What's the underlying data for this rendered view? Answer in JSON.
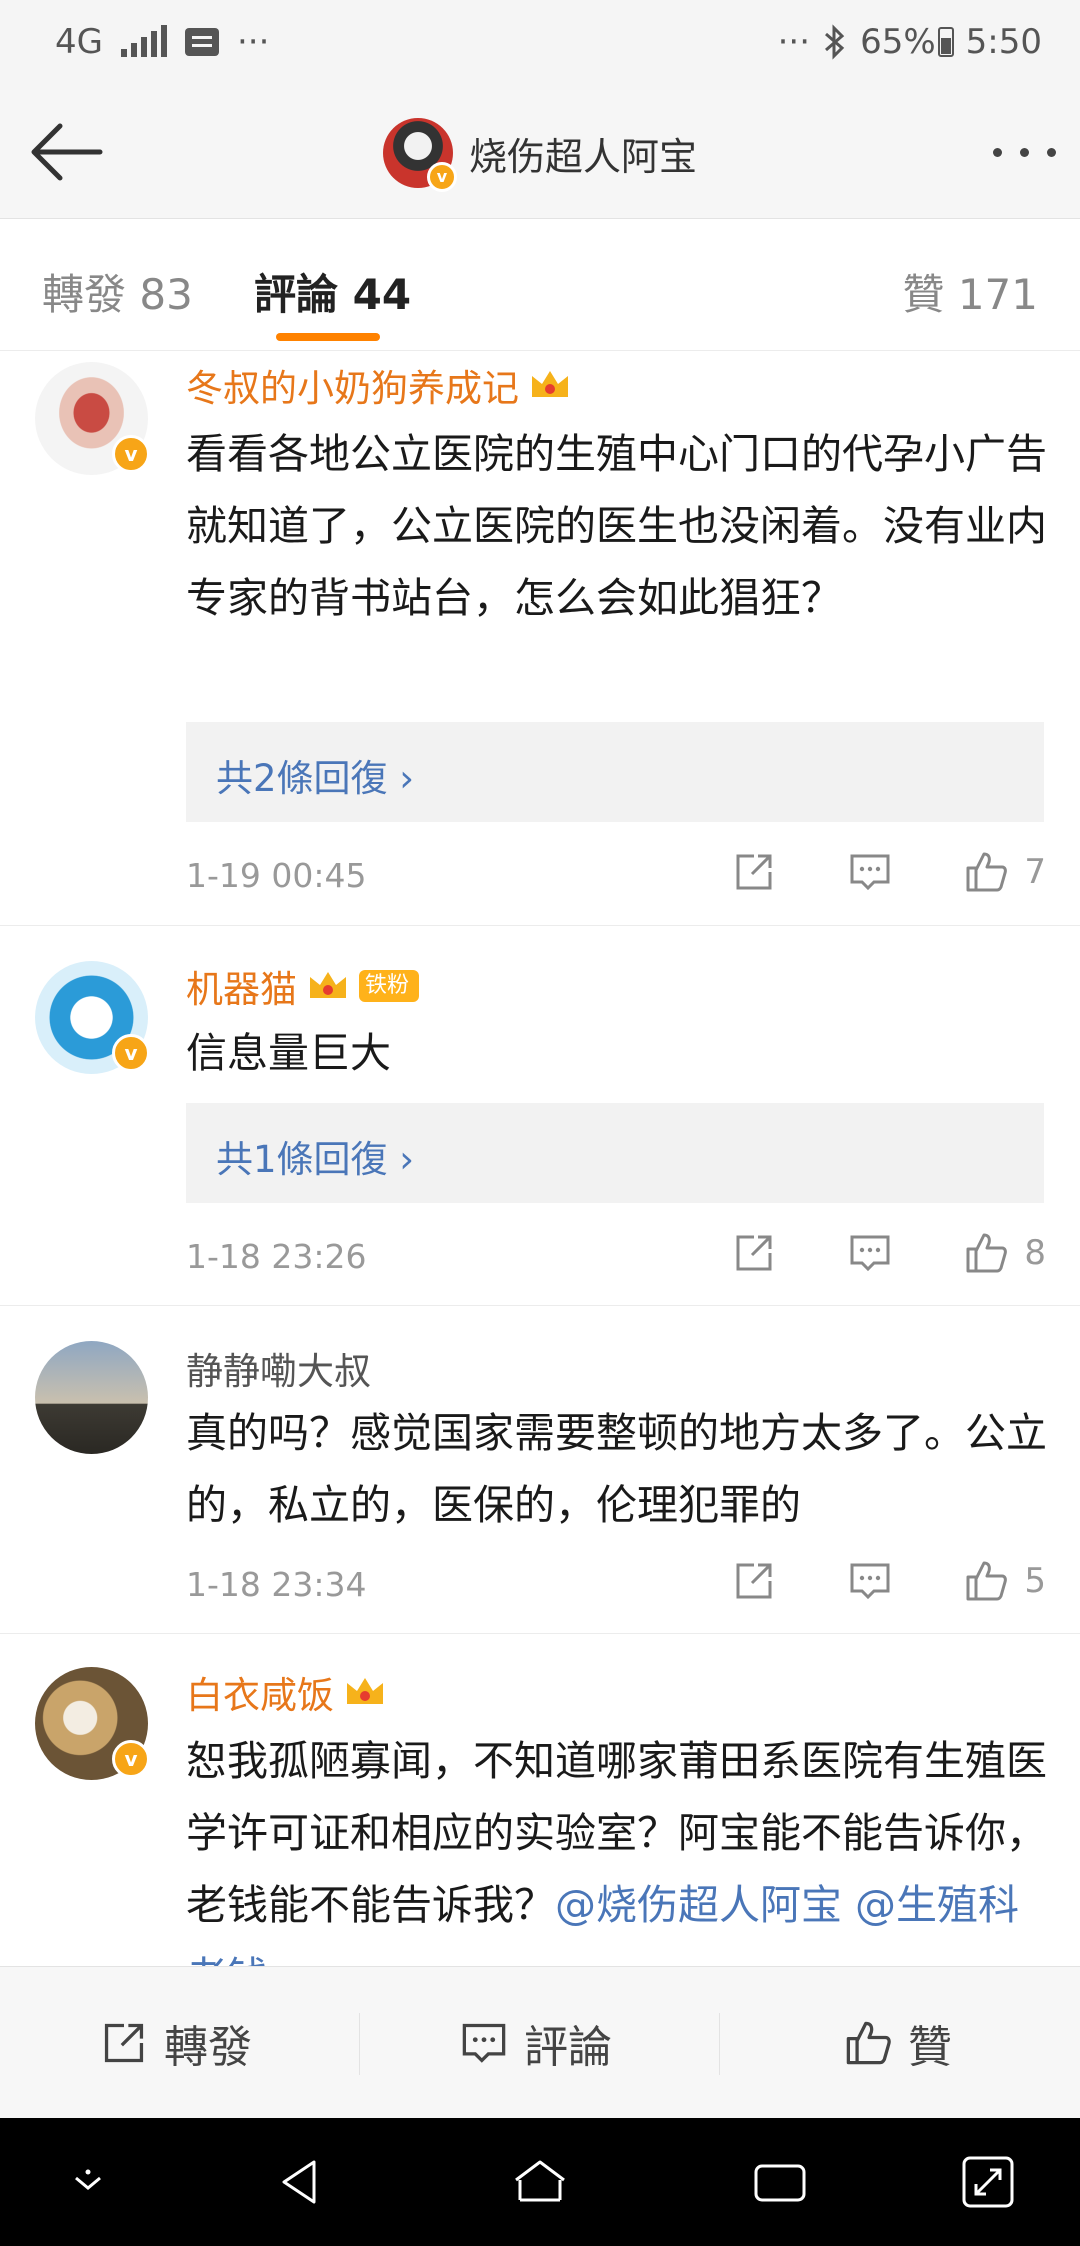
{
  "status_bar": {
    "network": "4G",
    "more_left": "···",
    "more_right": "···",
    "battery": "65%",
    "time": "5:50"
  },
  "header": {
    "title": "烧伤超人阿宝"
  },
  "tabs": [
    {
      "label": "轉發 83"
    },
    {
      "label": "評論 44"
    },
    {
      "label": "贊 171"
    }
  ],
  "comments": [
    {
      "user": "冬叔的小奶狗养成记",
      "text": "看看各地公立医院的生殖中心门口的代孕小广告就知道了，公立医院的医生也没闲着。没有业内专家的背书站台，怎么会如此猖狂？",
      "replies": "共2條回復",
      "time": "1-19 00:45",
      "likes": "7"
    },
    {
      "user": "机器猫",
      "badge": "铁粉",
      "text": "信息量巨大",
      "replies": "共1條回復",
      "time": "1-18 23:26",
      "likes": "8"
    },
    {
      "user": "静静嘞大叔",
      "text": "真的吗？感觉国家需要整顿的地方太多了。公立的，私立的，医保的，伦理犯罪的",
      "time": "1-18 23:34",
      "likes": "5"
    },
    {
      "user": "白衣咸饭",
      "text": "恕我孤陋寡闻，不知道哪家莆田系医院有生殖医学许可证和相应的实验室？阿宝能不能告诉你，老钱能不能告诉我？",
      "mention": "@烧伤超人阿宝 @生殖科老钱"
    }
  ],
  "bottom_bar": {
    "repost": "轉發",
    "comment": "評論",
    "like": "贊"
  }
}
